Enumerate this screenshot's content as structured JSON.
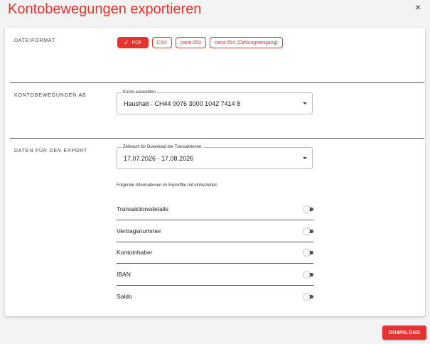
{
  "dialog": {
    "title": "Kontobewegungen exportieren",
    "close_icon": "×"
  },
  "format_section": {
    "label": "DATEIFORMAT",
    "options": [
      {
        "label": "PDF",
        "selected": true,
        "check_icon": "✓"
      },
      {
        "label": "CSV",
        "selected": false
      },
      {
        "label": "camt.053",
        "selected": false
      },
      {
        "label": "camt.054 (Zahlungseingang)",
        "selected": false
      }
    ]
  },
  "account_section": {
    "label": "KONTOBEWEGUNGEN AB",
    "select_label": "Konto auswählen",
    "select_value": "Haushalt - CH44 0076 3000 1042 7414 8"
  },
  "export_section": {
    "label": "DATEN FÜR DEN EXPORT",
    "period_label": "Zeitraum für Download der Transaktionen.",
    "period_value": "17.07.2026 - 17.08.2026",
    "info_text": "Folgende Informationen im Exportfile mit einbeziehen",
    "toggles": [
      {
        "label": "Transaktionsdetails",
        "on": false
      },
      {
        "label": "Vertragsnummer",
        "on": false
      },
      {
        "label": "Kontoinhaber",
        "on": false
      },
      {
        "label": "IBAN",
        "on": false
      },
      {
        "label": "Saldo",
        "on": false
      }
    ]
  },
  "actions": {
    "download_label": "DOWNLOAD"
  },
  "colors": {
    "accent": "#e8322e",
    "background": "#f3f3f3",
    "card": "#ffffff"
  }
}
